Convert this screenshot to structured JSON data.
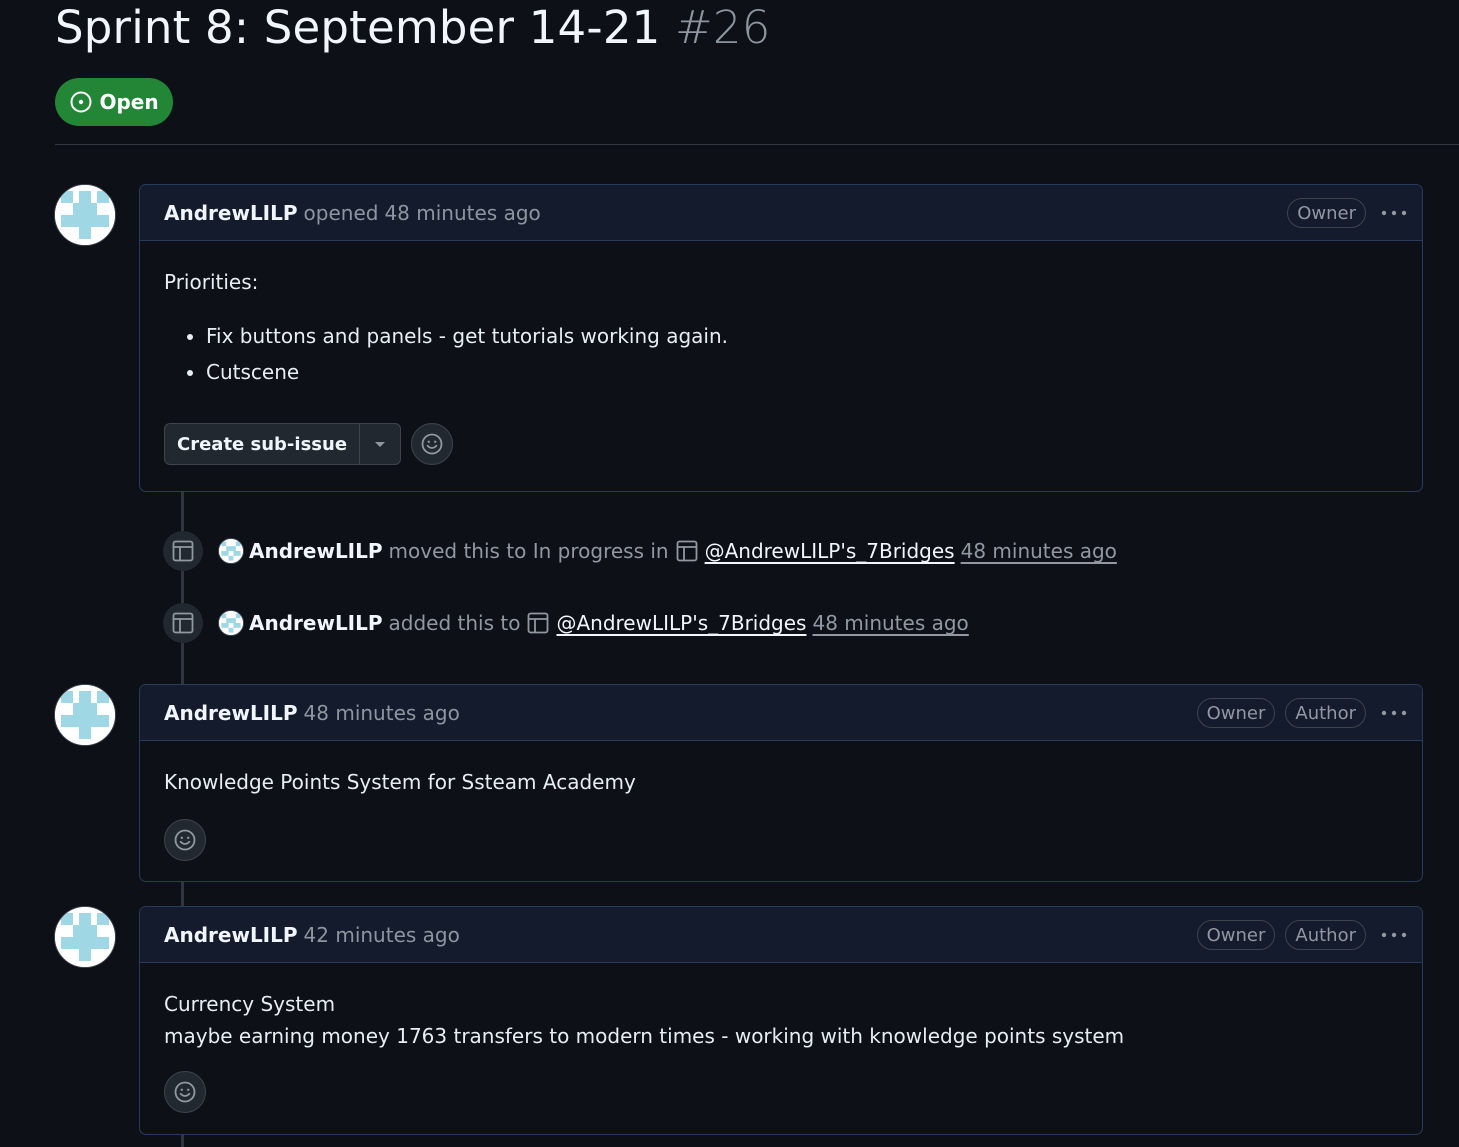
{
  "issue": {
    "title": "Sprint 8: September 14-21",
    "number": "#26",
    "state": "Open"
  },
  "comments": [
    {
      "author": "AndrewLILP",
      "action": "opened",
      "time": "48 minutes ago",
      "labels": [
        "Owner"
      ],
      "body_heading": "Priorities:",
      "body_list": [
        "Fix buttons and panels - get tutorials working again.",
        "Cutscene"
      ],
      "create_sub_issue_label": "Create sub-issue"
    },
    {
      "author": "AndrewLILP",
      "time": "48 minutes ago",
      "labels": [
        "Owner",
        "Author"
      ],
      "body_lines": [
        "Knowledge Points System for Ssteam Academy"
      ]
    },
    {
      "author": "AndrewLILP",
      "time": "42 minutes ago",
      "labels": [
        "Owner",
        "Author"
      ],
      "body_lines": [
        "Currency System",
        "maybe earning money 1763 transfers to modern times - working with knowledge points system"
      ]
    }
  ],
  "events": [
    {
      "actor": "AndrewLILP",
      "action": "moved this to In progress in",
      "project": "@AndrewLILP's_7Bridges",
      "time": "48 minutes ago"
    },
    {
      "actor": "AndrewLILP",
      "action": "added this to",
      "project": "@AndrewLILP's_7Bridges",
      "time": "48 minutes ago"
    }
  ],
  "icons": {
    "state": "issue-opened-icon",
    "event": "project-table-icon",
    "reaction": "smiley-icon",
    "menu": "kebab-horizontal-icon",
    "dropdown": "triangle-down-icon"
  },
  "colors": {
    "background": "#0d1117",
    "open_badge": "#238636",
    "comment_header": "#141b2c",
    "comment_border": "#2a3a5c",
    "identicon": "#9fd8e4"
  }
}
